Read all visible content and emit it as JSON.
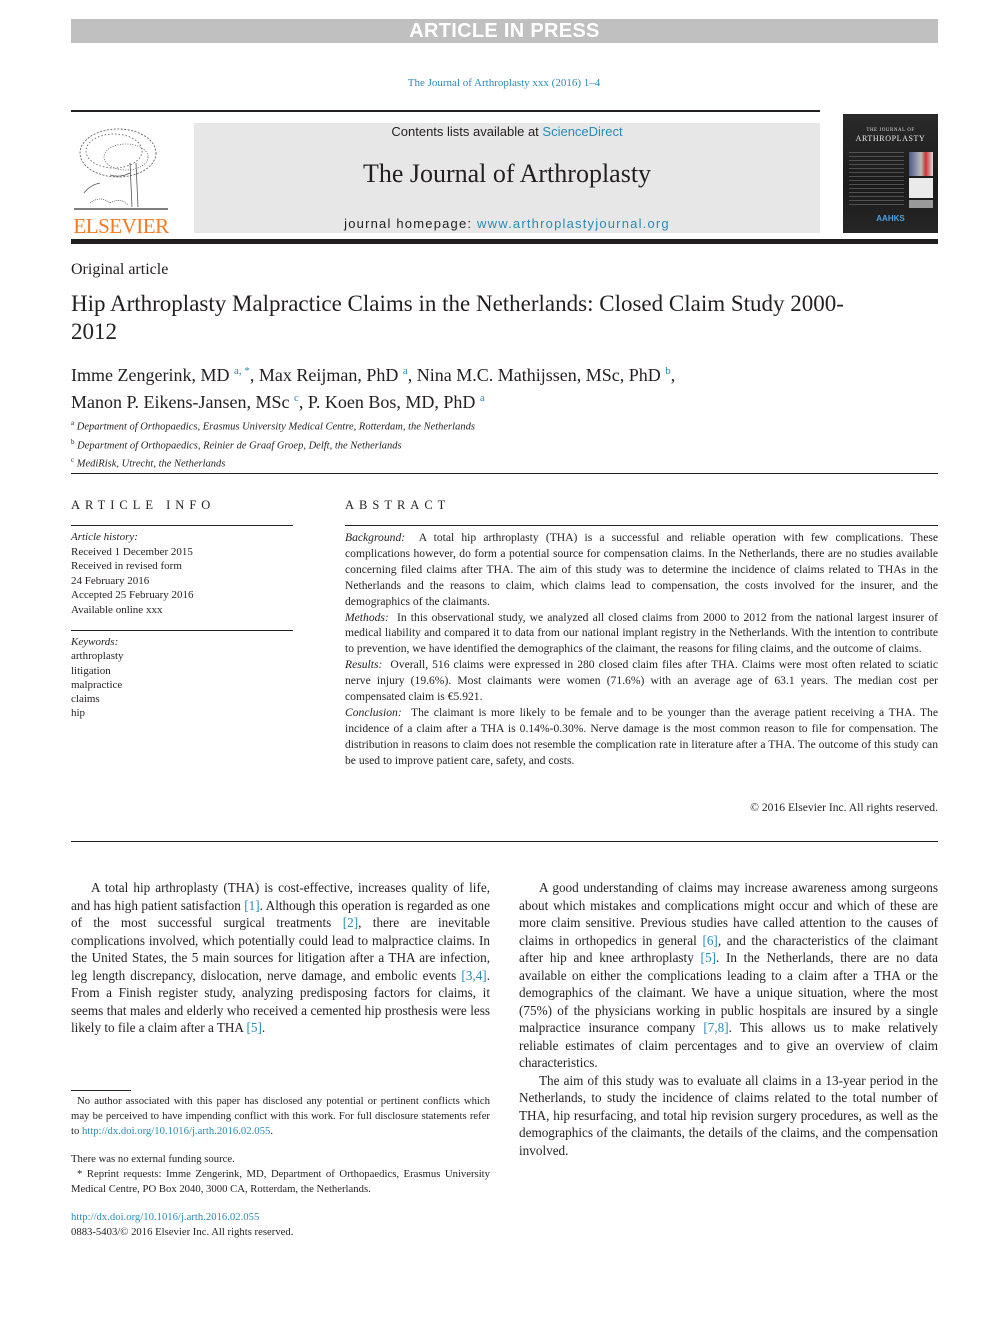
{
  "banner": {
    "label": "ARTICLE IN PRESS"
  },
  "citation": "The Journal of Arthroplasty xxx (2016) 1–4",
  "masthead": {
    "publisher_logo": "ELSEVIER",
    "contents_prefix": "Contents lists available at ",
    "contents_link": "ScienceDirect",
    "journal_name": "The Journal of Arthroplasty",
    "homepage_prefix": "journal homepage: ",
    "homepage_link": "www.arthroplastyjournal.org",
    "cover": {
      "small_title": "THE JOURNAL OF",
      "big_title": "ARTHROPLASTY",
      "society": "AAHKS"
    }
  },
  "article": {
    "type": "Original article",
    "title": "Hip Arthroplasty Malpractice Claims in the Netherlands: Closed Claim Study 2000-2012",
    "authors": [
      {
        "name": "Imme Zengerink, MD",
        "sup": "a, *",
        "sep": ", "
      },
      {
        "name": "Max Reijman, PhD",
        "sup": "a",
        "sep": ", "
      },
      {
        "name": "Nina M.C. Mathijssen, MSc, PhD",
        "sup": "b",
        "sep": ","
      },
      {
        "name": "Manon P. Eikens-Jansen, MSc",
        "sup": "c",
        "sep": ", "
      },
      {
        "name": "P. Koen Bos, MD, PhD",
        "sup": "a",
        "sep": ""
      }
    ],
    "affiliations": [
      {
        "key": "a",
        "text": "Department of Orthopaedics, Erasmus University Medical Centre, Rotterdam, the Netherlands"
      },
      {
        "key": "b",
        "text": "Department of Orthopaedics, Reinier de Graaf Groep, Delft, the Netherlands"
      },
      {
        "key": "c",
        "text": "MediRisk, Utrecht, the Netherlands"
      }
    ]
  },
  "article_info": {
    "heading": "ARTICLE INFO",
    "history_label": "Article history:",
    "history": [
      "Received 1 December 2015",
      "Received in revised form",
      "24 February 2016",
      "Accepted 25 February 2016",
      "Available online xxx"
    ],
    "keywords_label": "Keywords:",
    "keywords": [
      "arthroplasty",
      "litigation",
      "malpractice",
      "claims",
      "hip"
    ]
  },
  "abstract": {
    "heading": "ABSTRACT",
    "sections": [
      {
        "label": "Background:",
        "text": "A total hip arthroplasty (THA) is a successful and reliable operation with few complications. These complications however, do form a potential source for compensation claims. In the Netherlands, there are no studies available concerning filed claims after THA. The aim of this study was to determine the incidence of claims related to THAs in the Netherlands and the reasons to claim, which claims lead to compensation, the costs involved for the insurer, and the demographics of the claimants."
      },
      {
        "label": "Methods:",
        "text": "In this observational study, we analyzed all closed claims from 2000 to 2012 from the national largest insurer of medical liability and compared it to data from our national implant registry in the Netherlands. With the intention to contribute to prevention, we have identified the demographics of the claimant, the reasons for filing claims, and the outcome of claims."
      },
      {
        "label": "Results:",
        "text": "Overall, 516 claims were expressed in 280 closed claim files after THA. Claims were most often related to sciatic nerve injury (19.6%). Most claimants were women (71.6%) with an average age of 63.1 years. The median cost per compensated claim is €5.921."
      },
      {
        "label": "Conclusion:",
        "text": "The claimant is more likely to be female and to be younger than the average patient receiving a THA. The incidence of a claim after a THA is 0.14%-0.30%. Nerve damage is the most common reason to file for compensation. The distribution in reasons to claim does not resemble the complication rate in literature after a THA. The outcome of this study can be used to improve patient care, safety, and costs."
      }
    ],
    "copyright": "© 2016 Elsevier Inc. All rights reserved."
  },
  "body": {
    "left": [
      [
        {
          "t": "A total hip arthroplasty (THA) is cost-effective, increases quality of life, and has high patient satisfaction "
        },
        {
          "ref": "[1]"
        },
        {
          "t": ". Although this operation is regarded as one of the most successful surgical treatments "
        },
        {
          "ref": "[2]"
        },
        {
          "t": ", there are inevitable complications involved, which potentially could lead to malpractice claims. In the United States, the 5 main sources for litigation after a THA are infection, leg length discrepancy, dislocation, nerve damage, and embolic events "
        },
        {
          "ref": "[3,4]"
        },
        {
          "t": ". From a Finish register study, analyzing predisposing factors for claims, it seems that males and elderly who received a cemented hip prosthesis were less likely to file a claim after a THA "
        },
        {
          "ref": "[5]"
        },
        {
          "t": "."
        }
      ]
    ],
    "right": [
      [
        {
          "t": "A good understanding of claims may increase awareness among surgeons about which mistakes and complications might occur and which of these are more claim sensitive. Previous studies have called attention to the causes of claims in orthopedics in general "
        },
        {
          "ref": "[6]"
        },
        {
          "t": ", and the characteristics of the claimant after hip and knee arthroplasty "
        },
        {
          "ref": "[5]"
        },
        {
          "t": ". In the Netherlands, there are no data available on either the complications leading to a claim after a THA or the demographics of the claimant. We have a unique situation, where the most (75%) of the physicians working in public hospitals are insured by a single malpractice insurance company "
        },
        {
          "ref": "[7,8]"
        },
        {
          "t": ". This allows us to make relatively reliable estimates of claim percentages and to give an overview of claim characteristics."
        }
      ],
      [
        {
          "t": "The aim of this study was to evaluate all claims in a 13-year period in the Netherlands, to study the incidence of claims related to the total number of THA, hip resurfacing, and total hip revision surgery procedures, as well as the demographics of the claimants, the details of the claims, and the compensation involved."
        }
      ]
    ]
  },
  "footnotes": {
    "disclosure_text": "No author associated with this paper has disclosed any potential or pertinent conflicts which may be perceived to have impending conflict with this work. For full disclosure statements refer to ",
    "disclosure_link": "http://dx.doi.org/10.1016/j.arth.2016.02.055",
    "funding": "There was no external funding source.",
    "reprint": "* Reprint requests: Imme Zengerink, MD, Department of Orthopaedics, Erasmus University Medical Centre, PO Box 2040, 3000 CA, Rotterdam, the Netherlands.",
    "doi": "http://dx.doi.org/10.1016/j.arth.2016.02.055",
    "issn_copyright": "0883-5403/© 2016 Elsevier Inc. All rights reserved."
  },
  "colors": {
    "link": "#2a8ab8",
    "elsevier_orange": "#f47a20",
    "banner_gray": "#c0c0c0",
    "masthead_gray": "#e7e7e7"
  }
}
